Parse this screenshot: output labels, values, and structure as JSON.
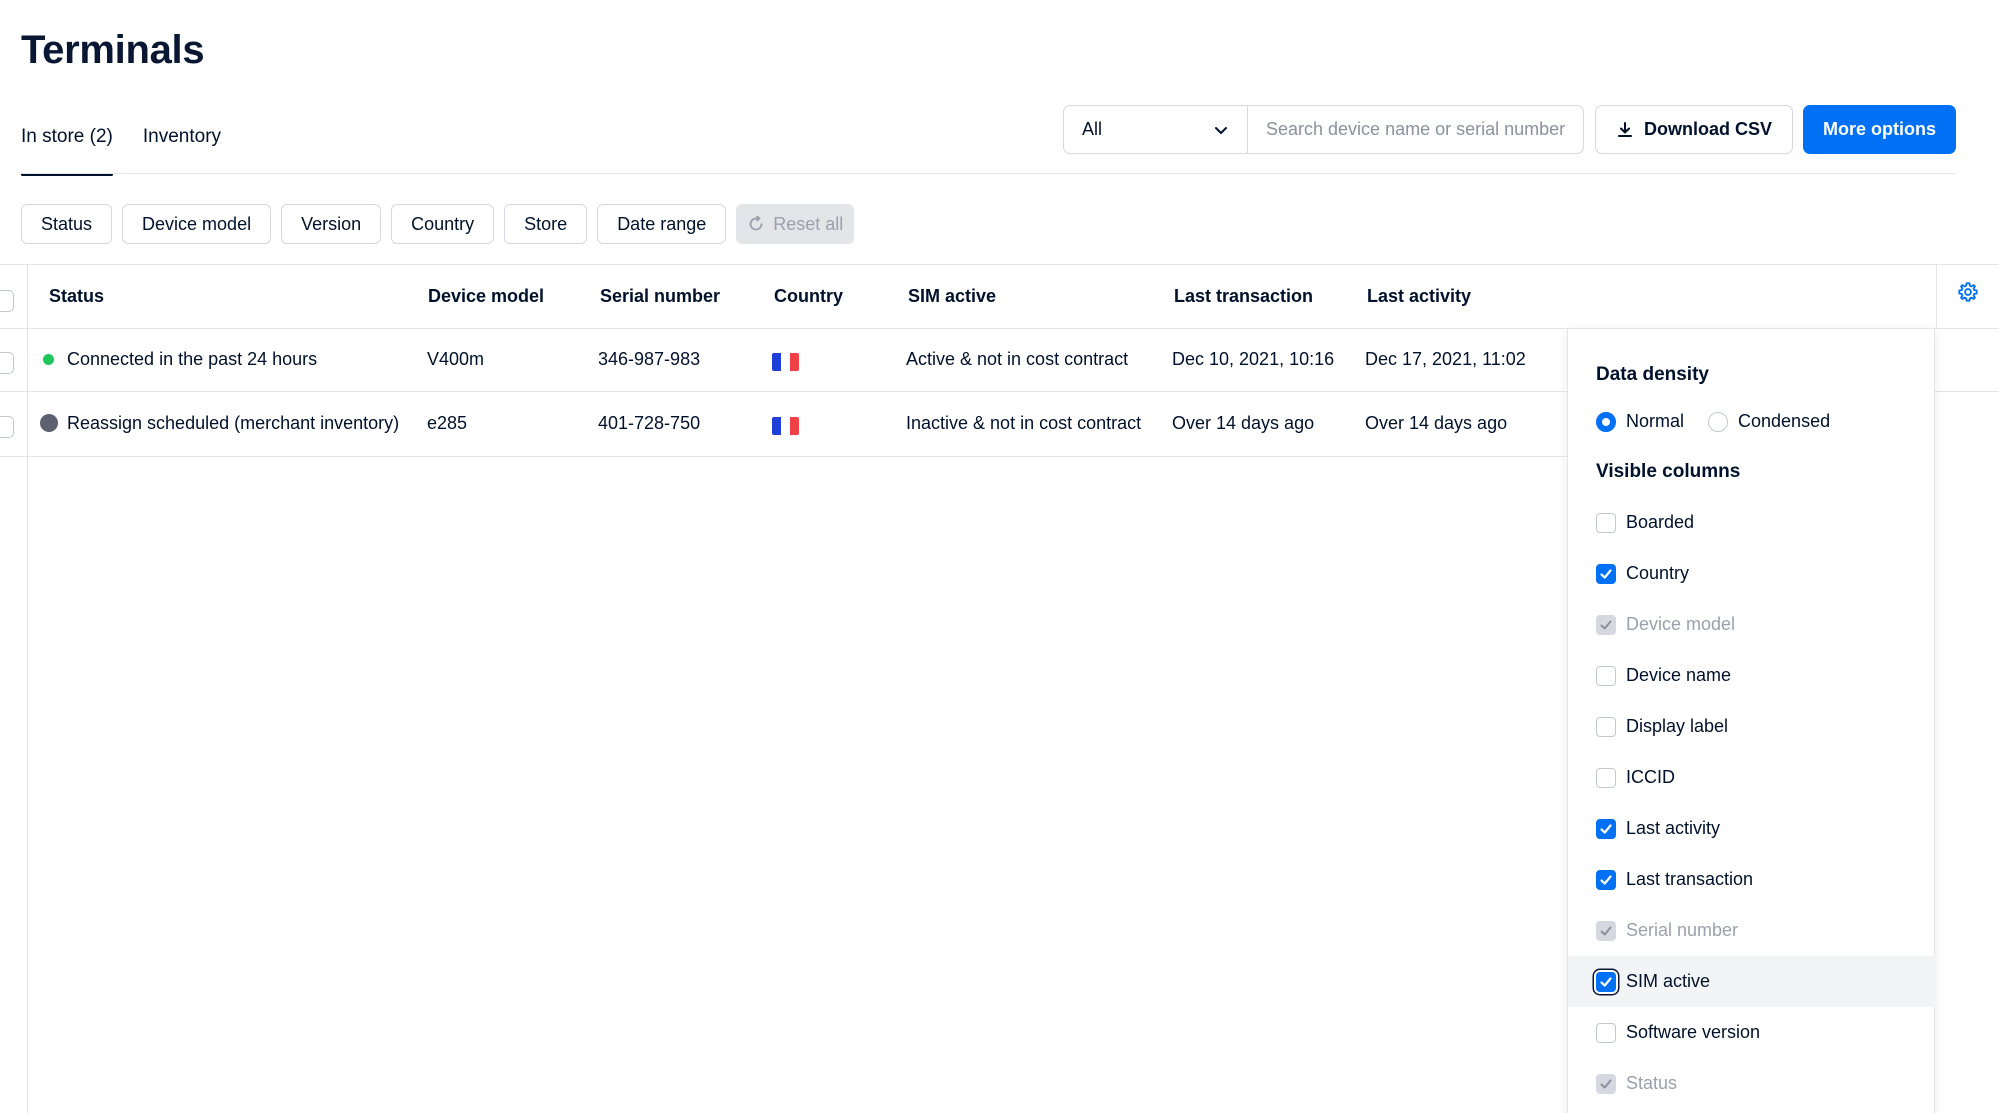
{
  "page": {
    "title": "Terminals"
  },
  "tabs": [
    {
      "label": "In store (2)",
      "active": true
    },
    {
      "label": "Inventory",
      "active": false
    }
  ],
  "toolbar": {
    "select_value": "All",
    "search_placeholder": "Search device name or serial number",
    "download_label": "Download CSV",
    "more_label": "More options"
  },
  "filters": [
    "Status",
    "Device model",
    "Version",
    "Country",
    "Store",
    "Date range"
  ],
  "reset_label": "Reset all",
  "table": {
    "headers": [
      "Status",
      "Device model",
      "Serial number",
      "Country",
      "SIM active",
      "Last transaction",
      "Last activity"
    ],
    "rows": [
      {
        "status": "Connected in the past 24 hours",
        "status_color": "#1ec75a",
        "device_model": "V400m",
        "serial": "346-987-983",
        "country_flag": "france-flag-icon",
        "sim": "Active & not in cost contract",
        "last_transaction": "Dec 10, 2021, 10:16",
        "last_activity": "Dec 17, 2021, 11:02"
      },
      {
        "status": "Reassign scheduled (merchant inventory)",
        "status_color": "#5c6170",
        "device_model": "e285",
        "serial": "401-728-750",
        "country_flag": "france-flag-icon",
        "sim": "Inactive & not in cost contract",
        "last_transaction": "Over 14 days ago",
        "last_activity": "Over 14 days ago"
      }
    ]
  },
  "panel": {
    "density_title": "Data density",
    "density_options": [
      {
        "label": "Normal",
        "selected": true
      },
      {
        "label": "Condensed",
        "selected": false
      }
    ],
    "columns_title": "Visible columns",
    "columns": [
      {
        "label": "Boarded",
        "checked": false,
        "disabled": false
      },
      {
        "label": "Country",
        "checked": true,
        "disabled": false
      },
      {
        "label": "Device model",
        "checked": true,
        "disabled": true
      },
      {
        "label": "Device name",
        "checked": false,
        "disabled": false
      },
      {
        "label": "Display label",
        "checked": false,
        "disabled": false
      },
      {
        "label": "ICCID",
        "checked": false,
        "disabled": false
      },
      {
        "label": "Last activity",
        "checked": true,
        "disabled": false
      },
      {
        "label": "Last transaction",
        "checked": true,
        "disabled": false
      },
      {
        "label": "Serial number",
        "checked": true,
        "disabled": true
      },
      {
        "label": "SIM active",
        "checked": true,
        "disabled": false,
        "highlighted": true
      },
      {
        "label": "Software version",
        "checked": false,
        "disabled": false
      },
      {
        "label": "Status",
        "checked": true,
        "disabled": true
      }
    ]
  },
  "colors": {
    "primary": "#0070f5",
    "text": "#00112c",
    "border": "#d5d8de",
    "flag_blue": "#1e3fd8",
    "flag_red": "#ef4146"
  }
}
